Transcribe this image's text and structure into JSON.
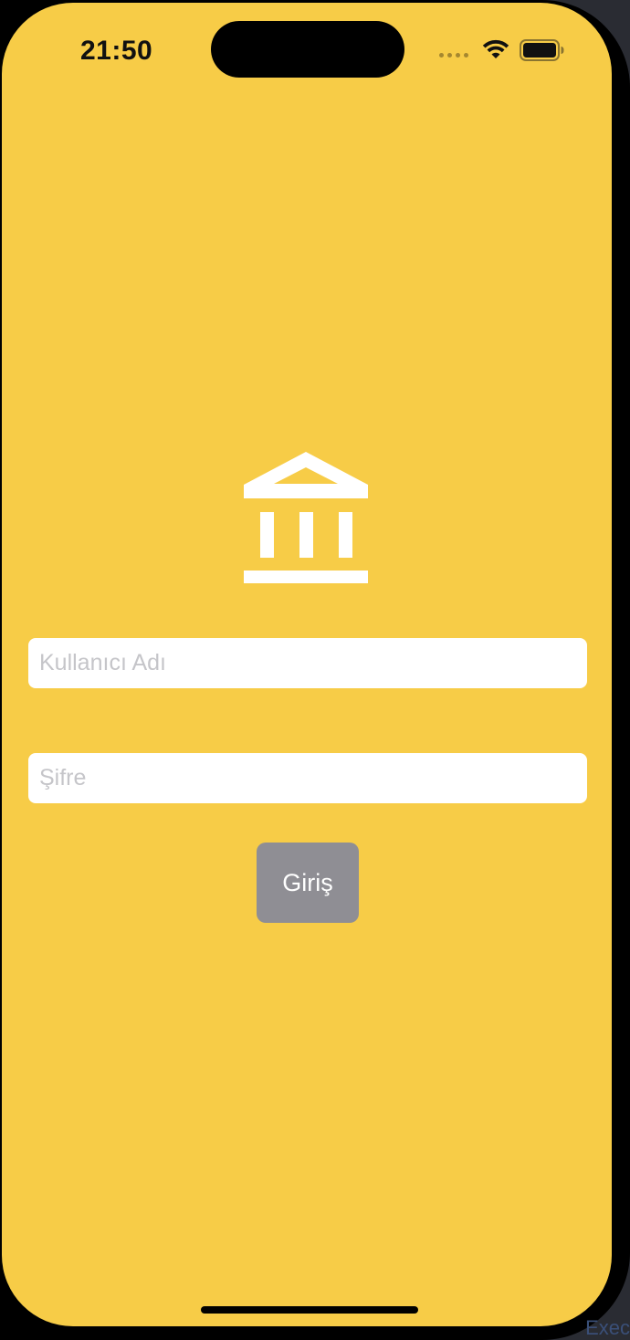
{
  "status_bar": {
    "time": "21:50"
  },
  "logo": {
    "icon": "bank-icon",
    "color": "#ffffff"
  },
  "login_form": {
    "username_placeholder": "Kullanıcı Adı",
    "username_value": "",
    "password_placeholder": "Şifre",
    "password_value": "",
    "submit_label": "Giriş"
  },
  "background_color": "#f7cc47",
  "button_color": "#8f8e94",
  "corner_text": "Exec"
}
